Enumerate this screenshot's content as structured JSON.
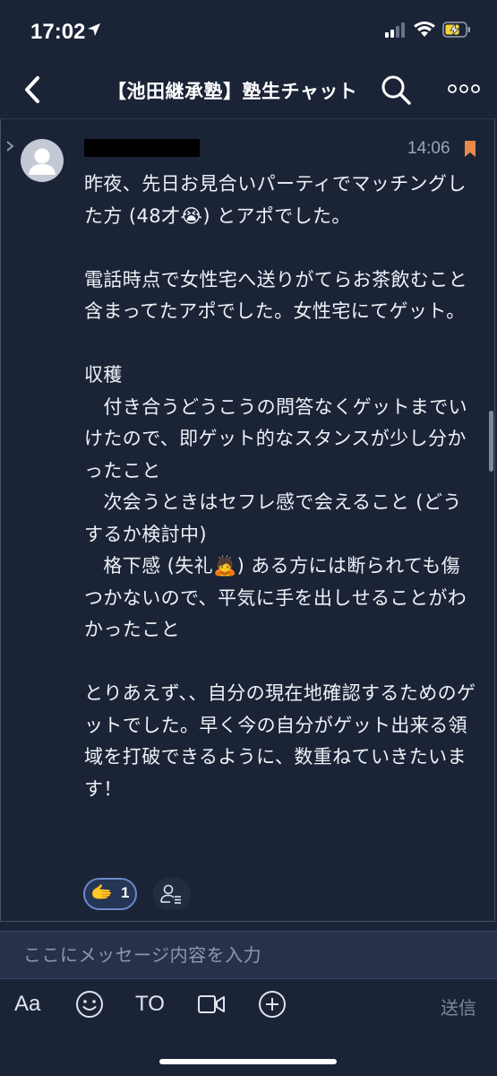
{
  "status_bar": {
    "time": "17:02",
    "icons": [
      "location-arrow-icon",
      "signal-icon",
      "wifi-icon",
      "battery-charging-icon"
    ]
  },
  "header": {
    "title": "【池田継承塾】塾生チャット",
    "icons": [
      "back-chevron-icon",
      "search-icon",
      "more-icon"
    ]
  },
  "message": {
    "time": "14:06",
    "text": "昨夜、先日お見合いパーティでマッチングした方 (48才😭) とアポでした。\n\n電話時点で女性宅へ送りがてらお茶飲むこと含まってたアポでした。女性宅にてゲット。\n\n収穫\n　付き合うどうこうの問答なくゲットまでいけたので、即ゲット的なスタンスが少し分かったこと\n　次会うときはセフレ感で会えること (どうするか検討中)\n　格下感 (失礼🙇) ある方には断られても傷つかないので、平気に手を出しせることがわかったこと\n\nとりあえず、、自分の現在地確認するためのゲットでした。早く今の自分がゲット出来る領域を打破できるように、数重ねていきたいます！",
    "reaction": {
      "emoji": "🫱",
      "icon": "handshake-icon",
      "count": "1"
    }
  },
  "composer": {
    "placeholder": "ここにメッセージ内容を入力"
  },
  "toolbar": {
    "aa_label": "Aa",
    "to_label": "TO",
    "send_label": "送信"
  },
  "colors": {
    "background": "#1b2436",
    "accent_bookmark": "#e8894a",
    "reaction_border": "#6b89c9"
  }
}
